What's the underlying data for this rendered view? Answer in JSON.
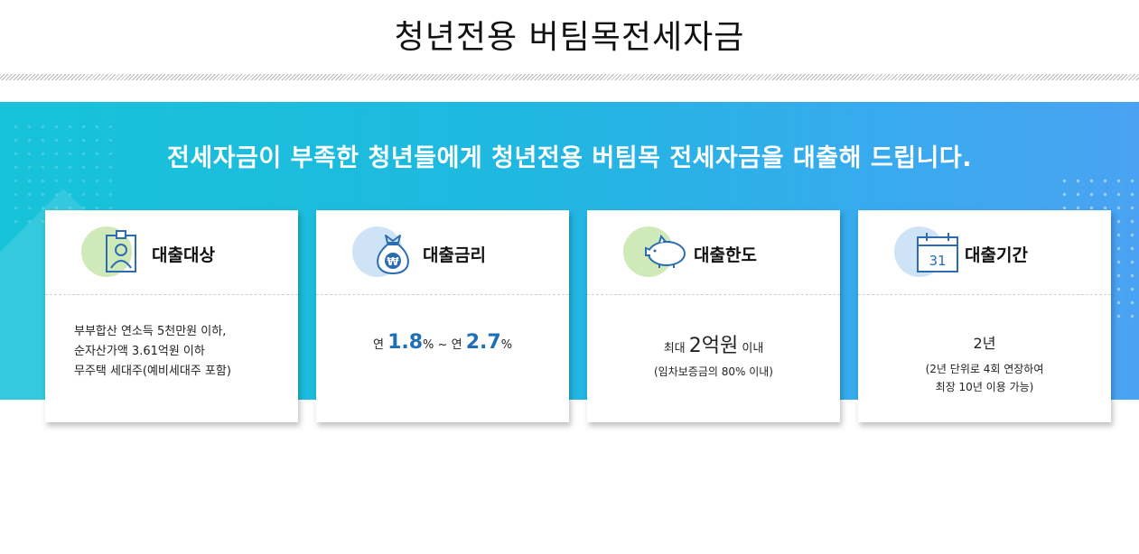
{
  "page": {
    "title": "청년전용 버팀목전세자금",
    "headline": "전세자금이 부족한 청년들에게 청년전용 버팀목 전세자금을 대출해 드립니다."
  },
  "colors": {
    "banner_start": "#17c3d9",
    "banner_end": "#4aa3f2",
    "highlight_blue": "#1e6fb8",
    "circle_green": "#cfe9b9",
    "circle_blue": "#cfe3f7"
  },
  "cards": [
    {
      "icon": "id-badge-icon",
      "title": "대출대상",
      "lines": [
        "부부합산 연소득 5천만원 이하,",
        "순자산가액 3.61억원 이하",
        "무주택 세대주(예비세대주 포함)"
      ]
    },
    {
      "icon": "money-bag-icon",
      "title": "대출금리",
      "prefix1": "연",
      "rate_min": "1.8",
      "unit1": "%",
      "separator": "~",
      "prefix2": "연",
      "rate_max": "2.7",
      "unit2": "%"
    },
    {
      "icon": "piggy-bank-icon",
      "title": "대출한도",
      "prefix": "최대",
      "amount": "2억원",
      "suffix": "이내",
      "note": "(임차보증금의 80% 이내)"
    },
    {
      "icon": "calendar-icon",
      "calendar_day": "31",
      "title": "대출기간",
      "period": "2년",
      "note_line1": "(2년 단위로 4회 연장하여",
      "note_line2": "최장 10년 이용 가능)"
    }
  ]
}
